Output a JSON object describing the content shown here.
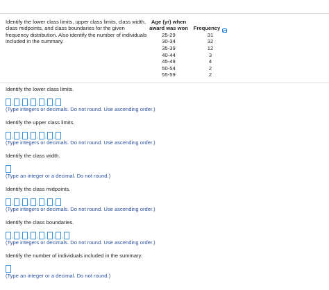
{
  "problem": {
    "text": "Identify the lower class limits, upper class limits, class width, class midpoints, and class boundaries for the given frequency distribution. Also identify the number of individuals included in the summary."
  },
  "table": {
    "header_age": "Age (yr) when award was won",
    "header_freq": "Frequency",
    "rows": [
      {
        "age": "25-29",
        "freq": "31"
      },
      {
        "age": "30-34",
        "freq": "32"
      },
      {
        "age": "35-39",
        "freq": "12"
      },
      {
        "age": "40-44",
        "freq": "3"
      },
      {
        "age": "45-49",
        "freq": "4"
      },
      {
        "age": "50-54",
        "freq": "2"
      },
      {
        "age": "55-59",
        "freq": "2"
      }
    ]
  },
  "questions": {
    "lower_limits": {
      "prompt": "Identify the lower class limits.",
      "hint": "(Type integers or decimals. Do not round. Use ascending order.)"
    },
    "upper_limits": {
      "prompt": "Identify the upper class limits.",
      "hint": "(Type integers or decimals. Do not round. Use ascending order.)"
    },
    "class_width": {
      "prompt": "Identify the class width.",
      "hint": "(Type an integer or a decimal. Do not round.)"
    },
    "midpoints": {
      "prompt": "Identify the class midpoints.",
      "hint": "(Type integers or decimals. Do not round. Use ascending order.)"
    },
    "boundaries": {
      "prompt": "Identify the class boundaries.",
      "hint": "(Type integers or decimals. Do not round. Use ascending order.)"
    },
    "individuals": {
      "prompt": "Identify the number of individuals included in the summary.",
      "hint": "(Type an integer or a decimal. Do not round.)"
    }
  },
  "separator": ",",
  "colors": {
    "accent": "#3b8fd6",
    "hint_text": "#2a4fa0",
    "rule": "#dcdcdc"
  },
  "icons": {
    "copy": "copy-icon"
  }
}
